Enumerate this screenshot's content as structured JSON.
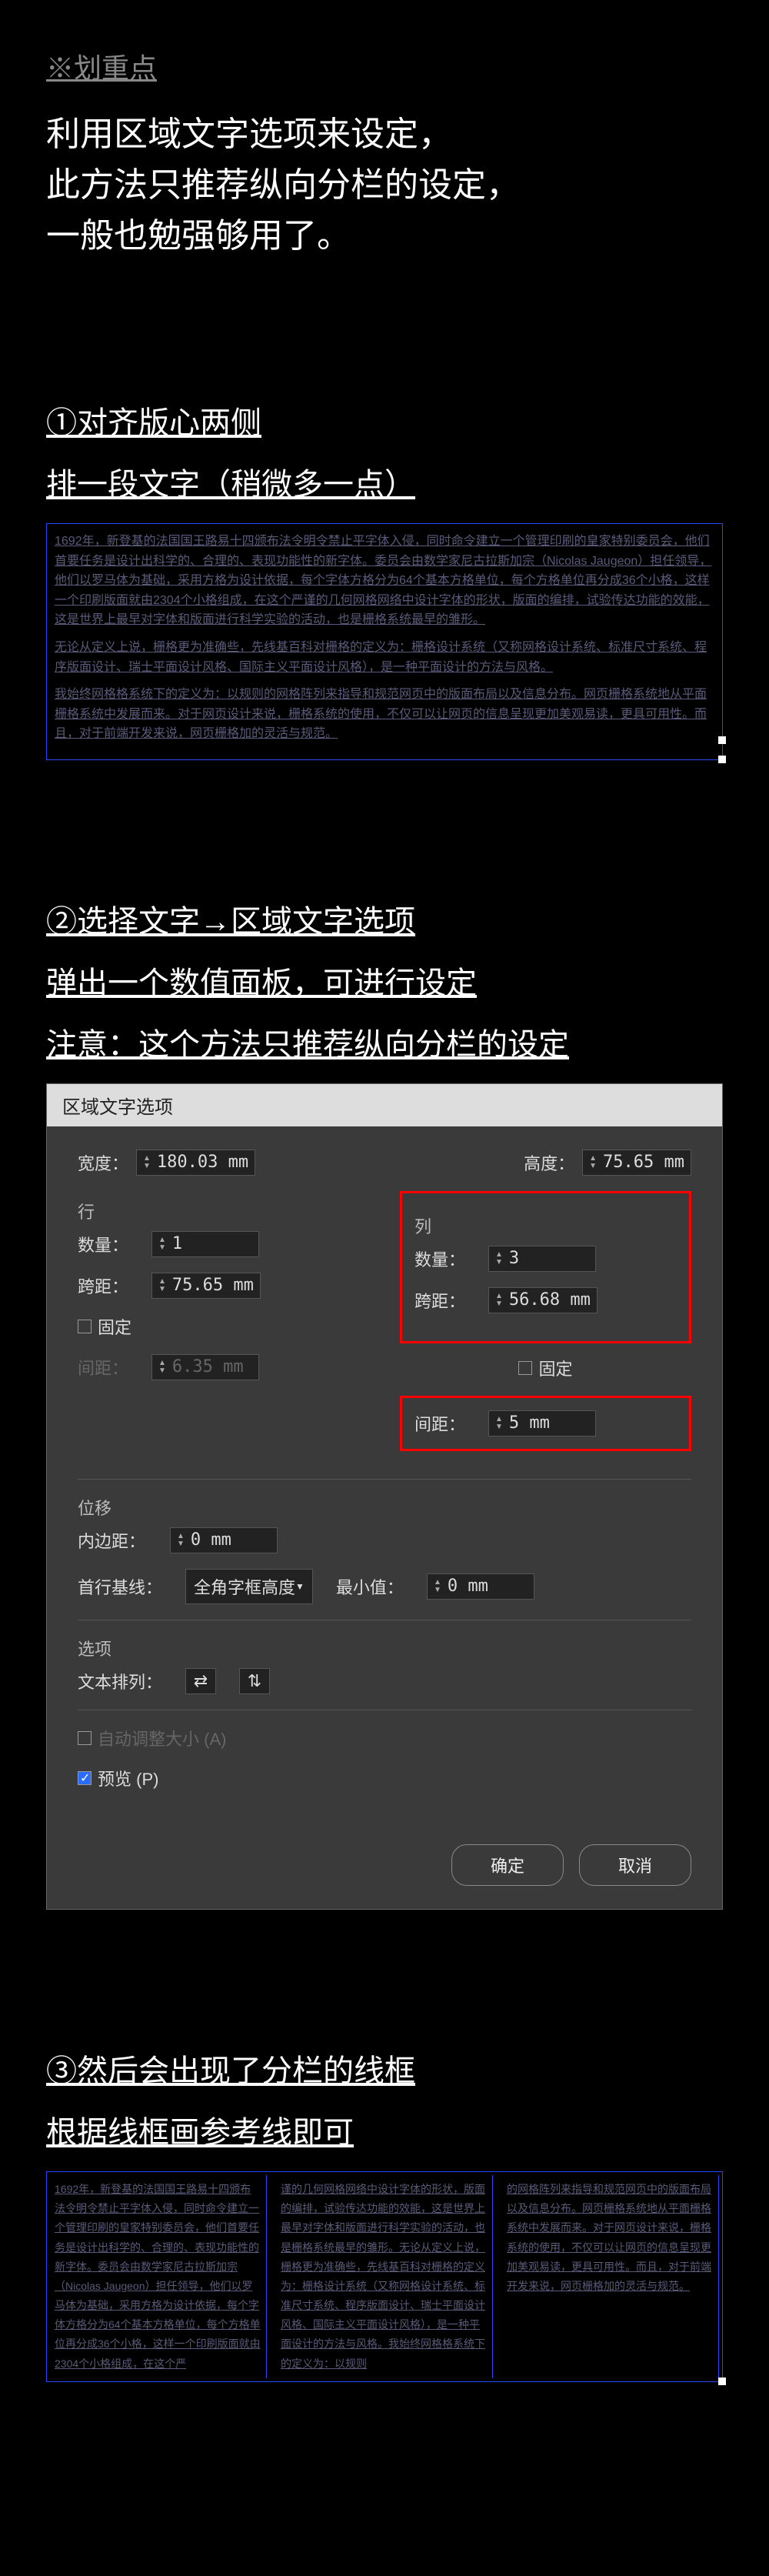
{
  "header": {
    "badge": "※划重点",
    "intro_l1": "利用区域文字选项来设定，",
    "intro_l2": "此方法只推荐纵向分栏的设定，",
    "intro_l3": "一般也勉强够用了。"
  },
  "step1": {
    "title": "①对齐版心两侧",
    "sub": "排一段文字（稍微多一点）",
    "p1": "1692年，新登基的法国国王路易十四颁布法令明令禁止平字体入侵，同时命令建立一个管理印刷的皇家特别委员会，他们首要任务是设计出科学的、合理的、表现功能性的新字体。委员会由数学家尼古拉斯加宗（Nicolas Jaugeon）担任领导，他们以罗马体为基础，采用方格为设计依据，每个字体方格分为64个基本方格单位，每个方格单位再分成36个小格，这样一个印刷版面就由2304个小格组成，在这个严谨的几何网格网络中设计字体的形状，版面的编排，试验传达功能的效能，这是世界上最早对字体和版面进行科学实验的活动，也是栅格系统最早的雏形。",
    "p2": "无论从定义上说，栅格更为准确些，先线基百科对栅格的定义为：栅格设计系统（又称网格设计系统、标准尺寸系统、程序版面设计、瑞士平面设计风格、国际主义平面设计风格），是一种平面设计的方法与风格。",
    "p3": "我始终网格格系统下的定义为：以规则的网格阵列来指导和规范网页中的版面布局以及信息分布。网页栅格系统地从平面栅格系统中发展而来。对于网页设计来说，栅格系统的使用，不仅可以让网页的信息呈现更加美观易读，更具可用性。而且，对于前端开发来说，网页栅格加的灵活与规范。"
  },
  "step2": {
    "title": "②选择文字→区域文字选项",
    "sub1": "弹出一个数值面板，可进行设定",
    "sub2": "注意：这个方法只推荐纵向分栏的设定"
  },
  "dialog": {
    "title": "区域文字选项",
    "width_label": "宽度：",
    "width_val": "180.03 mm",
    "height_label": "高度：",
    "height_val": "75.65 mm",
    "rows_header": "行",
    "cols_header": "列",
    "count_label": "数量：",
    "row_count": "1",
    "col_count": "3",
    "span_label": "跨距：",
    "row_span": "75.65 mm",
    "col_span": "56.68 mm",
    "fixed_label": "固定",
    "gap_label": "间距：",
    "row_gap": "6.35 mm",
    "col_gap": "5 mm",
    "offset_header": "位移",
    "inset_label": "内边距：",
    "inset_val": "0 mm",
    "baseline_label": "首行基线：",
    "baseline_val": "全角字框高度",
    "min_label": "最小值：",
    "min_val": "0 mm",
    "options_header": "选项",
    "flow_label": "文本排列：",
    "autosize_label": "自动调整大小 (A)",
    "preview_label": "预览 (P)",
    "ok": "确定",
    "cancel": "取消"
  },
  "step3": {
    "title": "③然后会出现了分栏的线框",
    "sub": "根据线框画参考线即可",
    "c1": "1692年，新登基的法国国王路易十四颁布法令明令禁止平字体入侵，同时命令建立一个管理印刷的皇家特别委员会，他们首要任务是设计出科学的、合理的、表现功能性的新字体。委员会由数学家尼古拉斯加宗（Nicolas Jaugeon）担任领导，他们以罗马体为基础，采用方格为设计依据，每个字体方格分为64个基本方格单位，每个方格单位再分成36个小格，这样一个印刷版面就由2304个小格组成，在这个严",
    "c2": "谨的几何网格网络中设计字体的形状，版面的编排，试验传达功能的效能，这是世界上最早对字体和版面进行科学实验的活动，也是栅格系统最早的雏形。无论从定义上说，栅格更为准确些，先线基百科对栅格的定义为：栅格设计系统（又称网格设计系统、标准尺寸系统、程序版面设计、瑞士平面设计风格、国际主义平面设计风格），是一种平面设计的方法与风格。我始终网格格系统下的定义为：以规则",
    "c3": "的网格阵列来指导和规范网页中的版面布局以及信息分布。网页栅格系统地从平面栅格系统中发展而来。对于网页设计来说，栅格系统的使用，不仅可以让网页的信息呈现更加美观易读，更具可用性。而且，对于前端开发来说，网页栅格加的灵活与规范。"
  }
}
